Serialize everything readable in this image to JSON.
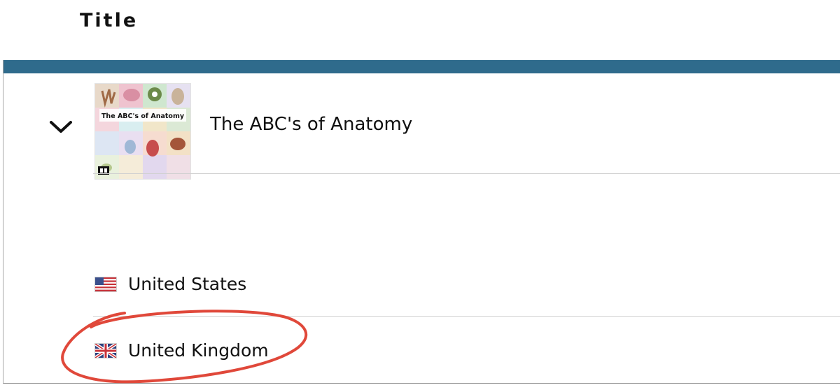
{
  "header": {
    "title": "Title"
  },
  "book": {
    "title": "The ABC's of Anatomy",
    "cover_text": "The ABC's of Anatomy"
  },
  "marketplaces": [
    {
      "label": "United States",
      "flag": "us-flag-icon"
    },
    {
      "label": "United Kingdom",
      "flag": "uk-flag-icon"
    }
  ],
  "colors": {
    "header_bar": "#2f6b8c",
    "annotation": "#e0483a"
  }
}
